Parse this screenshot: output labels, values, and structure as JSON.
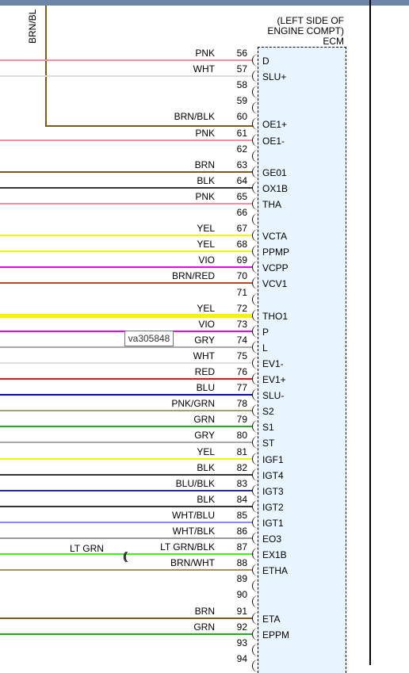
{
  "ecm": {
    "title_lines": [
      "(LEFT SIDE OF",
      "ENGINE COMPT)",
      "ECM"
    ]
  },
  "tooltip": "va305848",
  "vertical_wire_label": "BRN/BL",
  "inline_connector_color": "LT GRN",
  "pins": [
    {
      "pin": "56",
      "color": "PNK",
      "signal": "D",
      "hex": "#f48fa6"
    },
    {
      "pin": "57",
      "color": "WHT",
      "signal": "SLU+",
      "hex": "#dddddd"
    },
    {
      "pin": "58",
      "color": "",
      "signal": "",
      "hex": ""
    },
    {
      "pin": "59",
      "color": "",
      "signal": "",
      "hex": ""
    },
    {
      "pin": "60",
      "color": "BRN/BLK",
      "signal": "OE1+",
      "hex": ""
    },
    {
      "pin": "61",
      "color": "PNK",
      "signal": "OE1-",
      "hex": "#f48fa6"
    },
    {
      "pin": "62",
      "color": "",
      "signal": "",
      "hex": ""
    },
    {
      "pin": "63",
      "color": "BRN",
      "signal": "GE01",
      "hex": "#7a5c1e"
    },
    {
      "pin": "64",
      "color": "BLK",
      "signal": "OX1B",
      "hex": "#333333"
    },
    {
      "pin": "65",
      "color": "PNK",
      "signal": "THA",
      "hex": "#f48fa6"
    },
    {
      "pin": "66",
      "color": "",
      "signal": "",
      "hex": ""
    },
    {
      "pin": "67",
      "color": "YEL",
      "signal": "VCTA",
      "hex": "#f5f500"
    },
    {
      "pin": "68",
      "color": "YEL",
      "signal": "PPMP",
      "hex": "#f5f500"
    },
    {
      "pin": "69",
      "color": "VIO",
      "signal": "VCPP",
      "hex": "#ee00ee"
    },
    {
      "pin": "70",
      "color": "BRN/RED",
      "signal": "VCV1",
      "hex": "#b5471e"
    },
    {
      "pin": "71",
      "color": "",
      "signal": "",
      "hex": ""
    },
    {
      "pin": "72",
      "color": "YEL",
      "signal": "THO1",
      "hex": "#f5f500"
    },
    {
      "pin": "73",
      "color": "VIO",
      "signal": "P",
      "hex": "#ee00ee"
    },
    {
      "pin": "74",
      "color": "GRY",
      "signal": "L",
      "hex": "#aaaaaa"
    },
    {
      "pin": "75",
      "color": "WHT",
      "signal": "EV1-",
      "hex": "#dddddd"
    },
    {
      "pin": "76",
      "color": "RED",
      "signal": "EV1+",
      "hex": "#ee1111"
    },
    {
      "pin": "77",
      "color": "BLU",
      "signal": "SLU-",
      "hex": "#0000dd"
    },
    {
      "pin": "78",
      "color": "PNK/GRN",
      "signal": "S2",
      "hex": "#a8a070"
    },
    {
      "pin": "79",
      "color": "GRN",
      "signal": "S1",
      "hex": "#22aa22"
    },
    {
      "pin": "80",
      "color": "GRY",
      "signal": "ST",
      "hex": "#aaaaaa"
    },
    {
      "pin": "81",
      "color": "YEL",
      "signal": "IGF1",
      "hex": "#f5f500"
    },
    {
      "pin": "82",
      "color": "BLK",
      "signal": "IGT4",
      "hex": "#333333"
    },
    {
      "pin": "83",
      "color": "BLU/BLK",
      "signal": "IGT3",
      "hex": "#2a2a88"
    },
    {
      "pin": "84",
      "color": "BLK",
      "signal": "IGT2",
      "hex": "#333333"
    },
    {
      "pin": "85",
      "color": "WHT/BLU",
      "signal": "IGT1",
      "hex": "#8888ee"
    },
    {
      "pin": "86",
      "color": "WHT/BLK",
      "signal": "EO3",
      "hex": "#999999"
    },
    {
      "pin": "87",
      "color": "LT GRN/BLK",
      "signal": "EX1B",
      "hex": "#44ee22"
    },
    {
      "pin": "88",
      "color": "BRN/WHT",
      "signal": "ETHA",
      "hex": "#a89060"
    },
    {
      "pin": "89",
      "color": "",
      "signal": "",
      "hex": ""
    },
    {
      "pin": "90",
      "color": "",
      "signal": "",
      "hex": ""
    },
    {
      "pin": "91",
      "color": "BRN",
      "signal": "ETA",
      "hex": "#7a5c1e"
    },
    {
      "pin": "92",
      "color": "GRN",
      "signal": "EPPM",
      "hex": "#22aa22"
    },
    {
      "pin": "93",
      "color": "",
      "signal": "",
      "hex": ""
    },
    {
      "pin": "94",
      "color": "",
      "signal": "",
      "hex": ""
    }
  ]
}
